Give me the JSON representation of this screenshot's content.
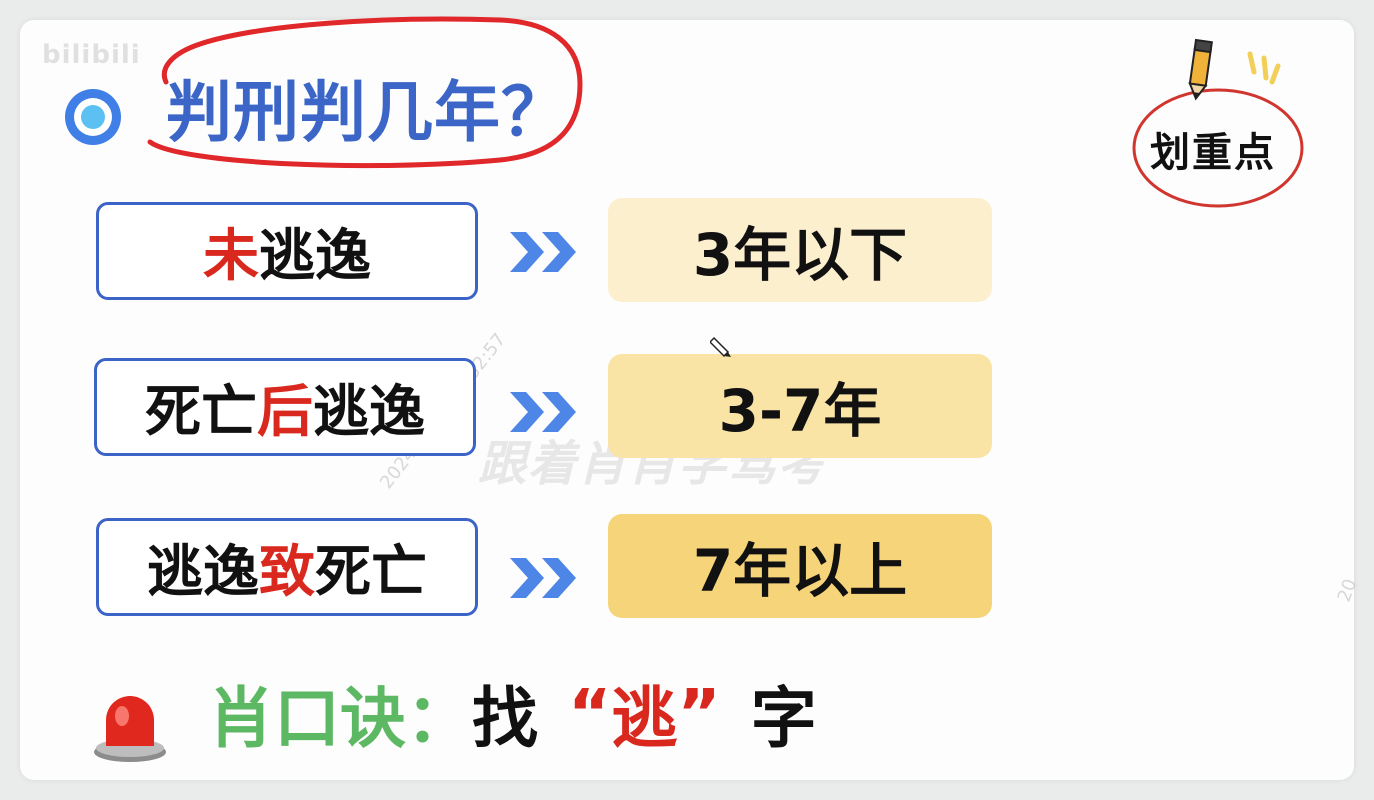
{
  "watermark": {
    "brand": "bilibili",
    "overlay": "跟着肖肖学驾考",
    "timestamp": "2024-09-29 18:32:57",
    "edge": "20"
  },
  "title": "判刑判几年？",
  "stamp": "划重点",
  "rows": [
    {
      "label_prefix": "",
      "label_red": "未",
      "label_suffix": "逃逸",
      "result": "3年以下",
      "result_color": "#fcefce"
    },
    {
      "label_prefix": "死亡",
      "label_red": "后",
      "label_suffix": "逃逸",
      "result": "3-7年",
      "result_color": "#f9e3a5"
    },
    {
      "label_prefix": "逃逸",
      "label_red": "致",
      "label_suffix": "死亡",
      "result": "7年以上",
      "result_color": "#f6d57a"
    }
  ],
  "mnemonic": {
    "head": "肖口诀：",
    "find": "找",
    "open_quote": "“",
    "key": "逃",
    "close_quote": "”",
    "tail": "字"
  },
  "colors": {
    "title_blue": "#3b66c8",
    "accent_red": "#d9291f",
    "green": "#5db864",
    "arrow_blue": "#4e86e8"
  }
}
